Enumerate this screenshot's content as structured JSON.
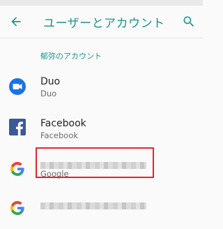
{
  "appbar": {
    "title": "ユーザーとアカウント",
    "back_icon": "arrow-left-icon",
    "search_icon": "search-icon"
  },
  "section": {
    "header": "郁弥のアカウント"
  },
  "accounts": [
    {
      "name": "Duo",
      "type": "Duo",
      "icon": "duo-icon"
    },
    {
      "name": "Facebook",
      "type": "Facebook",
      "icon": "facebook-icon"
    },
    {
      "name": "",
      "type": "Google",
      "icon": "google-icon",
      "redacted": true,
      "highlighted": true
    },
    {
      "name": "",
      "type": "",
      "icon": "google-icon",
      "redacted": true
    }
  ],
  "colors": {
    "accent": "#1a9688",
    "highlight": "#e3262b",
    "duo": "#1a73e8",
    "facebook": "#3b5998"
  }
}
